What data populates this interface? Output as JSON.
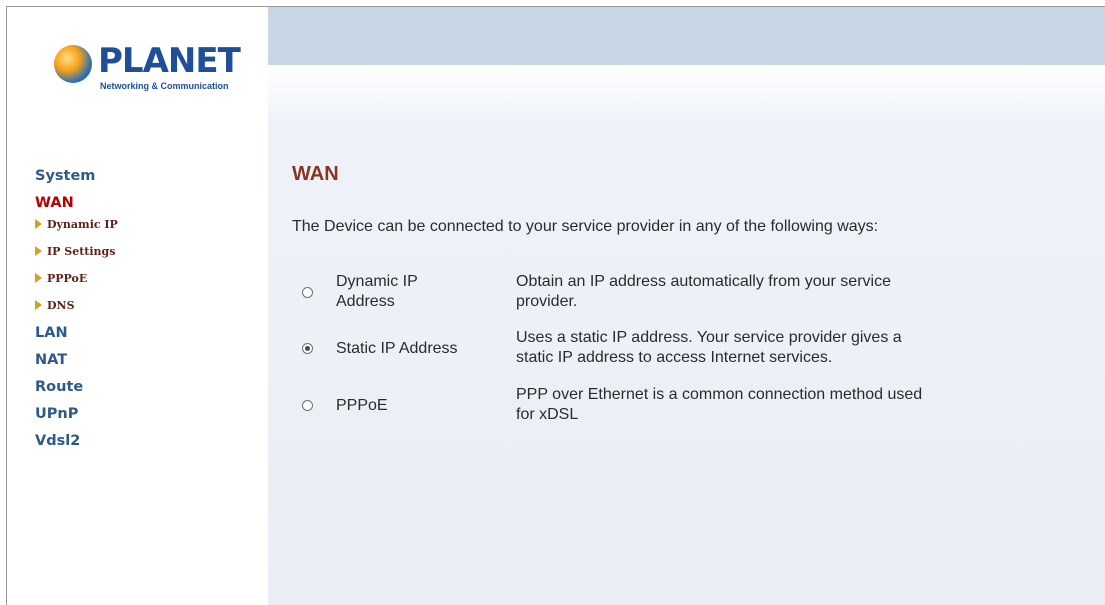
{
  "logo": {
    "brand": "PLANET",
    "tagline": "Networking & Communication"
  },
  "sidebar": {
    "items": [
      {
        "label": "System",
        "active": false
      },
      {
        "label": "WAN",
        "active": true
      },
      {
        "label": "Dynamic IP",
        "sub": true
      },
      {
        "label": "IP Settings",
        "sub": true
      },
      {
        "label": "PPPoE",
        "sub": true
      },
      {
        "label": "DNS",
        "sub": true
      },
      {
        "label": "LAN",
        "active": false
      },
      {
        "label": "NAT",
        "active": false
      },
      {
        "label": "Route",
        "active": false
      },
      {
        "label": "UPnP",
        "active": false
      },
      {
        "label": "Vdsl2",
        "active": false
      }
    ]
  },
  "main": {
    "title": "WAN",
    "intro": "The Device can be connected to your service provider in any of the following ways:",
    "options": [
      {
        "label_line1": "Dynamic IP",
        "label_line2": "Address",
        "desc_line1": "Obtain an IP address automatically from your service",
        "desc_line2": "provider.",
        "selected": false
      },
      {
        "label_line1": "Static IP Address",
        "label_line2": "",
        "desc_line1": "Uses a static IP address. Your service provider gives a",
        "desc_line2": "static IP address to access Internet services.",
        "selected": true
      },
      {
        "label_line1": "PPPoE",
        "label_line2": "",
        "desc_line1": "PPP over Ethernet is a common connection method used",
        "desc_line2": "for xDSL",
        "selected": false
      }
    ]
  },
  "colors": {
    "menu_link": "#2d5a8a",
    "menu_active": "#b40000",
    "title": "#8a3424",
    "topbar": "#c9d6e6"
  }
}
